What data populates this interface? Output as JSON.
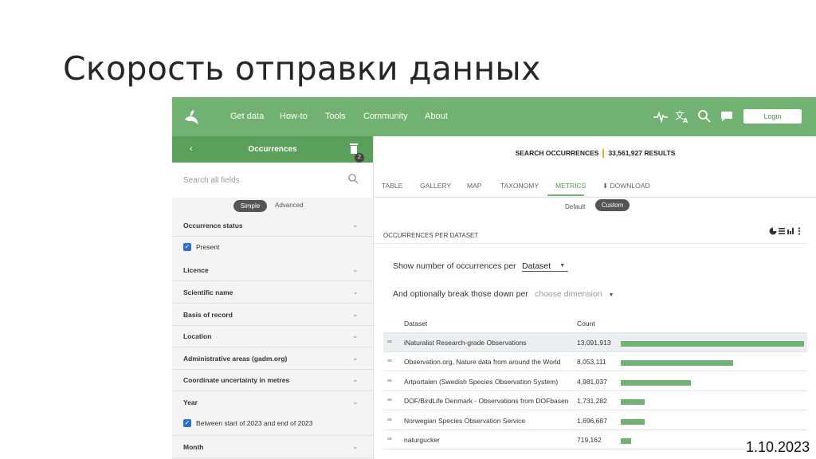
{
  "slide": {
    "title": "Скорость отправки данных",
    "date": "1.10.2023"
  },
  "nav": {
    "items": [
      "Get data",
      "How-to",
      "Tools",
      "Community",
      "About"
    ],
    "login": "Login",
    "icons": [
      "activity-icon",
      "translate-icon",
      "search-icon",
      "chat-icon"
    ]
  },
  "sidebar": {
    "back": "‹",
    "title": "Occurrences",
    "badge": "2",
    "search_placeholder": "Search all fields",
    "modes": {
      "simple": "Simple",
      "advanced": "Advanced"
    },
    "filters": {
      "occurrence_status": "Occurrence status",
      "present": "Present",
      "licence": "Licence",
      "scientific_name": "Scientific name",
      "basis_of_record": "Basis of record",
      "location": "Location",
      "admin_areas": "Administrative areas (gadm.org)",
      "coord_uncertainty": "Coordinate uncertainty in metres",
      "year": "Year",
      "year_value": "Between start of 2023 and end of 2023",
      "month": "Month"
    }
  },
  "main": {
    "summary_label": "SEARCH OCCURRENCES",
    "summary_count": "33,561,927 RESULTS",
    "tabs": {
      "table": "TABLE",
      "gallery": "GALLERY",
      "map": "MAP",
      "taxonomy": "TAXONOMY",
      "metrics": "METRICS",
      "download": "⬇ DOWNLOAD"
    },
    "view": {
      "default": "Default",
      "custom": "Custom"
    },
    "panel_title": "OCCURRENCES PER DATASET",
    "question1": "Show number of occurrences per",
    "question1_value": "Dataset",
    "question2": "And optionally break those down per",
    "question2_value": "choose dimension",
    "columns": {
      "dataset": "Dataset",
      "count": "Count"
    },
    "rows": [
      {
        "name": "iNaturalist Research-grade Observations",
        "count": "13,091,913",
        "value": 13091913
      },
      {
        "name": "Observation.org, Nature data from around the World",
        "count": "8,053,111",
        "value": 8053111
      },
      {
        "name": "Artportalen (Swedish Species Observation System)",
        "count": "4,981,037",
        "value": 4981037
      },
      {
        "name": "DOF/BirdLife Denmark - Observations from DOFbasen",
        "count": "1,731,282",
        "value": 1731282
      },
      {
        "name": "Norwegian Species Observation Service",
        "count": "1,696,687",
        "value": 1696687
      },
      {
        "name": "naturgucker",
        "count": "719,162",
        "value": 719162
      }
    ]
  },
  "colors": {
    "accent": "#71b171",
    "sidebar_header": "#5aa05a",
    "highlight": "#e4b32b"
  }
}
